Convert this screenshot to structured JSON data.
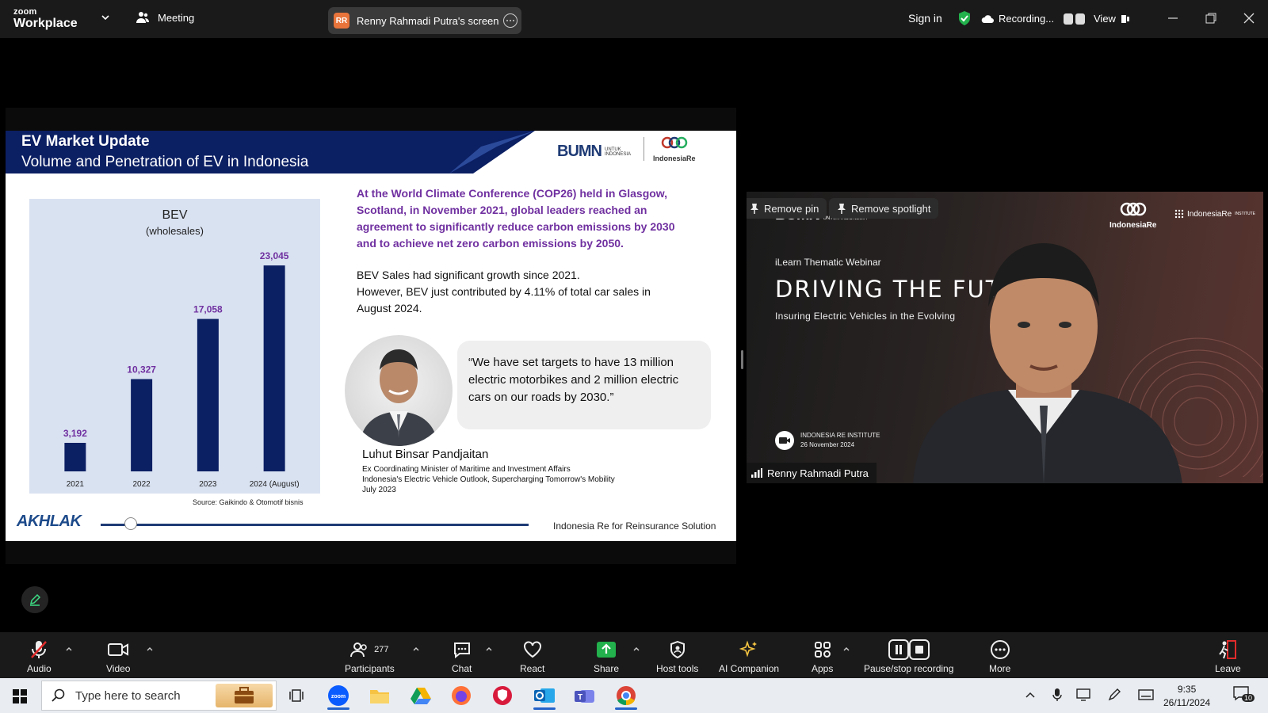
{
  "app": {
    "brand_small": "zoom",
    "brand_name": "Workplace",
    "meeting_label": "Meeting",
    "share_badge": "RR",
    "share_label": "Renny Rahmadi Putra's screen",
    "sign_in": "Sign in",
    "recording_label": "Recording...",
    "view_label": "View"
  },
  "slide": {
    "title": "EV Market Update",
    "subtitle": "Volume and Penetration of EV in Indonesia",
    "logo_bumn": "BUMN",
    "logo_bumn_tag1": "UNTUK",
    "logo_bumn_tag2": "INDONESIA",
    "logo_ire": "IndonesiaRe",
    "paragraph1_lines": [
      "At the World Climate Conference (COP26) held in Glasgow,",
      "Scotland, in November 2021, global leaders reached an",
      "agreement to significantly reduce carbon emissions by 2030",
      "and to achieve net zero carbon emissions by 2050."
    ],
    "paragraph2_lines": [
      "BEV Sales had significant growth since 2021.",
      "However, BEV just contributed by 4.11% of total car sales in",
      "August 2024."
    ],
    "quote_lines": [
      "“We have set targets to have 13 million",
      "electric motorbikes and 2 million electric",
      "cars on our roads by 2030.”"
    ],
    "speaker_name": "Luhut Binsar Pandjaitan",
    "speaker_role": "Ex Coordinating Minister of Maritime and Investment Affairs",
    "speaker_source": "Indonesia's Electric Vehicle Outlook, Supercharging Tomorrow's Mobility",
    "speaker_date": "July 2023",
    "footer_logo": "AKHLAK",
    "footer_text": "Indonesia Re for Reinsurance Solution",
    "chart_source": "Source: Gaikindo & Otomotif bisnis"
  },
  "chart_data": {
    "type": "bar",
    "title": "BEV",
    "subtitle": "(wholesales)",
    "categories": [
      "2021",
      "2022",
      "2023",
      "2024 (August)"
    ],
    "values": [
      3192,
      10327,
      17058,
      23045
    ],
    "data_labels": [
      "3,192",
      "10,327",
      "17,058",
      "23,045"
    ],
    "ylim": [
      0,
      25000
    ],
    "bar_color": "#0b1f63",
    "label_color": "#7030a0",
    "background": "#d9e2f1",
    "grid": false
  },
  "video": {
    "remove_pin": "Remove pin",
    "remove_spotlight": "Remove spotlight",
    "bg_logo_left": "BUMN",
    "bg_logo_left_tag": "UNTUK INDONESIA",
    "bg_logo_right": "IndonesiaRe",
    "bg_logo_right2": "IndonesiaRe",
    "bg_logo_right2_tag": "INSTITUTE",
    "bg_ilearn": "iLearn Thematic Webinar",
    "bg_headline": "DRIVING THE FUT",
    "bg_subline": "Insuring Electric Vehicles in the Evolving",
    "bg_institute": "INDONESIA RE INSTITUTE",
    "bg_date": "26 November 2024",
    "participant_name": "Renny Rahmadi Putra"
  },
  "toolbar": {
    "audio": "Audio",
    "video": "Video",
    "participants": "Participants",
    "participants_count": "277",
    "chat": "Chat",
    "react": "React",
    "share": "Share",
    "host_tools": "Host tools",
    "ai_companion": "AI Companion",
    "apps": "Apps",
    "pause_stop": "Pause/stop recording",
    "more": "More",
    "leave": "Leave"
  },
  "taskbar": {
    "search_placeholder": "Type here to search",
    "time": "9:35",
    "date": "26/11/2024",
    "notifications": "10"
  },
  "colors": {
    "slide_header": "#0b1f63",
    "purple": "#7030a0",
    "zoom_blue": "#0b5cff",
    "share_green": "#22b14c"
  }
}
